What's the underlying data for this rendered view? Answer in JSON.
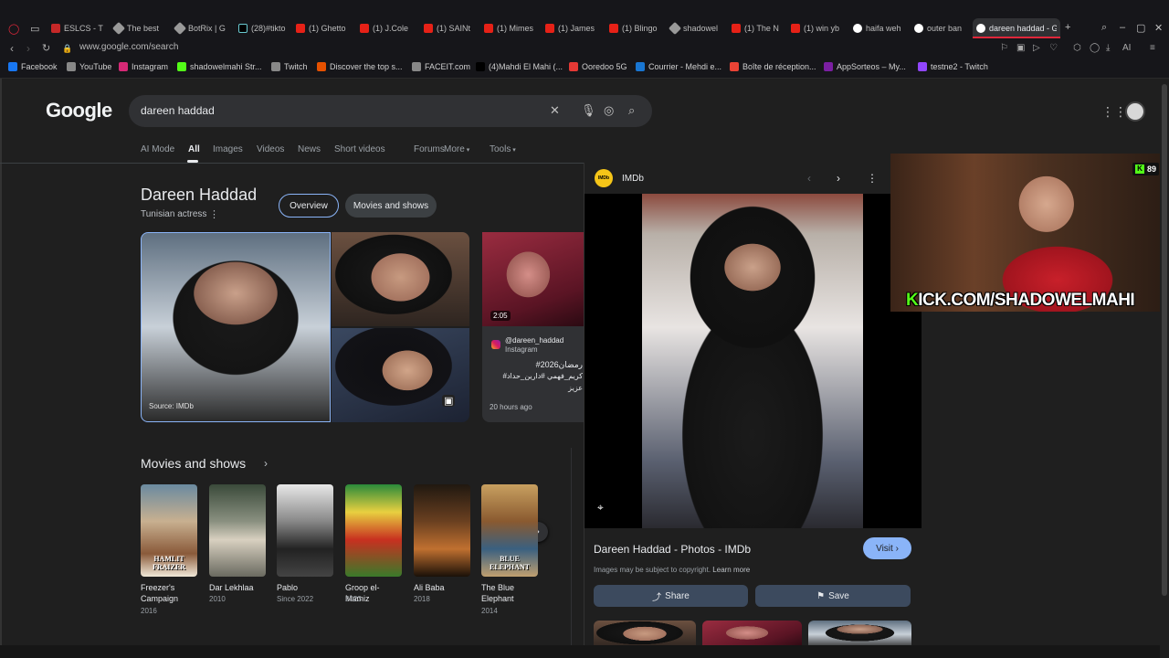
{
  "browser": {
    "tabs": [
      {
        "label": "ESLCS - T",
        "icon": "red"
      },
      {
        "label": "The best",
        "icon": "d"
      },
      {
        "label": "BotRix | G",
        "icon": "d"
      },
      {
        "label": "(28)#tikto",
        "icon": "tk"
      },
      {
        "label": "(1) Ghetto",
        "icon": "yt"
      },
      {
        "label": "(1) J.Cole",
        "icon": "yt"
      },
      {
        "label": "(1) SAINt",
        "icon": "yt"
      },
      {
        "label": "(1) Mimes",
        "icon": "yt"
      },
      {
        "label": "(1) James",
        "icon": "yt"
      },
      {
        "label": "(1) Blingo",
        "icon": "yt"
      },
      {
        "label": "shadowel",
        "icon": "d"
      },
      {
        "label": "(1) The N",
        "icon": "yt"
      },
      {
        "label": "(1) win yb",
        "icon": "yt"
      },
      {
        "label": "haifa weh",
        "icon": "g"
      },
      {
        "label": "outer ban",
        "icon": "g"
      },
      {
        "label": "dareen haddad - G",
        "icon": "g"
      }
    ],
    "url": "www.google.com/search",
    "ai_label": "AI",
    "bookmarks": [
      {
        "label": "Facebook",
        "color": "#1877f2"
      },
      {
        "label": "YouTube",
        "color": "#888888"
      },
      {
        "label": "Instagram",
        "color": "#d62976"
      },
      {
        "label": "shadowelmahi Str...",
        "color": "#53fc18"
      },
      {
        "label": "Twitch",
        "color": "#888888"
      },
      {
        "label": "Discover the top s...",
        "color": "#e65100"
      },
      {
        "label": "FACEIT.com",
        "color": "#888888"
      },
      {
        "label": "(4)Mahdi El Mahi (...",
        "color": "#000000"
      },
      {
        "label": "Ooredoo 5G",
        "color": "#e53935"
      },
      {
        "label": "Courrier - Mehdi e...",
        "color": "#1976d2"
      },
      {
        "label": "Boîte de réception...",
        "color": "#ea4335"
      },
      {
        "label": "AppSorteos – My...",
        "color": "#7b1fa2"
      },
      {
        "label": "testne2 - Twitch",
        "color": "#9146ff"
      }
    ]
  },
  "google": {
    "logo": "Google",
    "query": "dareen haddad",
    "filters": [
      "AI Mode",
      "All",
      "Images",
      "Videos",
      "News",
      "Short videos",
      "Forums",
      "More",
      "Tools"
    ],
    "active_filter": "All"
  },
  "knowledge_panel": {
    "title": "Dareen Haddad",
    "subtitle": "Tunisian actress",
    "pill_overview": "Overview",
    "pill_movies": "Movies and shows",
    "main_image_source": "Source: IMDb",
    "instagram": {
      "duration": "2:05",
      "handle": "@dareen_haddad",
      "source": "Instagram",
      "caption_1": "#رمضان2026",
      "caption_2": "#كريم_فهمي #دارين_حداد",
      "caption_3": "عزيز",
      "time": "20 hours ago"
    }
  },
  "movies": {
    "title": "Movies and shows",
    "items": [
      {
        "title": "Freezer's Campaign",
        "year": "2016",
        "poster": "HAMLIT FRAIZER"
      },
      {
        "title": "Dar Lekhlaa",
        "year": "2010",
        "poster": ""
      },
      {
        "title": "Pablo",
        "year": "Since 2022",
        "poster": ""
      },
      {
        "title": "Groop el-Mamiz",
        "year": "2023",
        "poster": ""
      },
      {
        "title": "Ali Baba",
        "year": "2018",
        "poster": ""
      },
      {
        "title": "The Blue Elephant",
        "year": "2014",
        "poster": "BLUE ELEPHANT"
      }
    ]
  },
  "viewer": {
    "source": "IMDb",
    "favicon_text": "IMDb",
    "title": "Dareen Haddad - Photos - IMDb",
    "visit": "Visit",
    "copyright": "Images may be subject to copyright.",
    "learn_more": "Learn more",
    "share": "Share",
    "save": "Save"
  },
  "stream": {
    "channel_text": "KICK.COM/SHADOWELMAHI",
    "viewer_count": "89",
    "brand_color": "#53fc18"
  }
}
